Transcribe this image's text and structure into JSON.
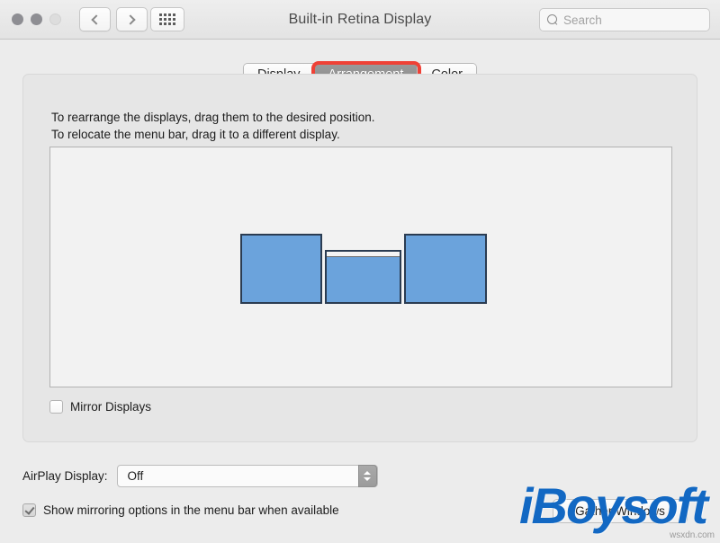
{
  "window": {
    "title": "Built-in Retina Display",
    "traffic_lights": [
      {
        "name": "close",
        "color": "#8e8e93"
      },
      {
        "name": "minimize",
        "color": "#8e8e93"
      },
      {
        "name": "zoom",
        "color": "#dddddd"
      }
    ]
  },
  "toolbar": {
    "back_icon": "chevron-left-icon",
    "forward_icon": "chevron-right-icon",
    "grid_icon": "grid-apps-icon",
    "search": {
      "icon": "search-icon",
      "placeholder": "Search",
      "value": ""
    }
  },
  "tabs": [
    {
      "label": "Display",
      "selected": false
    },
    {
      "label": "Arrangement",
      "selected": true
    },
    {
      "label": "Color",
      "selected": false
    }
  ],
  "annotation": {
    "type": "rectangle-highlight",
    "target": "Arrangement",
    "color": "#ef4136"
  },
  "panel": {
    "instructions_line1": "To rearrange the displays, drag them to the desired position.",
    "instructions_line2": "To relocate the menu bar, drag it to a different display.",
    "displays": [
      {
        "name": "display-left",
        "has_menu_bar": false,
        "color": "#6ba3dc"
      },
      {
        "name": "display-middle",
        "has_menu_bar": true,
        "color": "#6ba3dc"
      },
      {
        "name": "display-right",
        "has_menu_bar": false,
        "color": "#6ba3dc"
      }
    ],
    "mirror_displays": {
      "label": "Mirror Displays",
      "checked": false
    }
  },
  "bottom": {
    "airplay_label": "AirPlay Display:",
    "airplay_value": "Off",
    "airplay_options": [
      "Off"
    ],
    "show_mirroring": {
      "label": "Show mirroring options in the menu bar when available",
      "checked": true
    },
    "gather_windows_label": "Gather Windows"
  },
  "watermarks": {
    "logo_text": "iBoysoft",
    "site_text": "wsxdn.com"
  }
}
